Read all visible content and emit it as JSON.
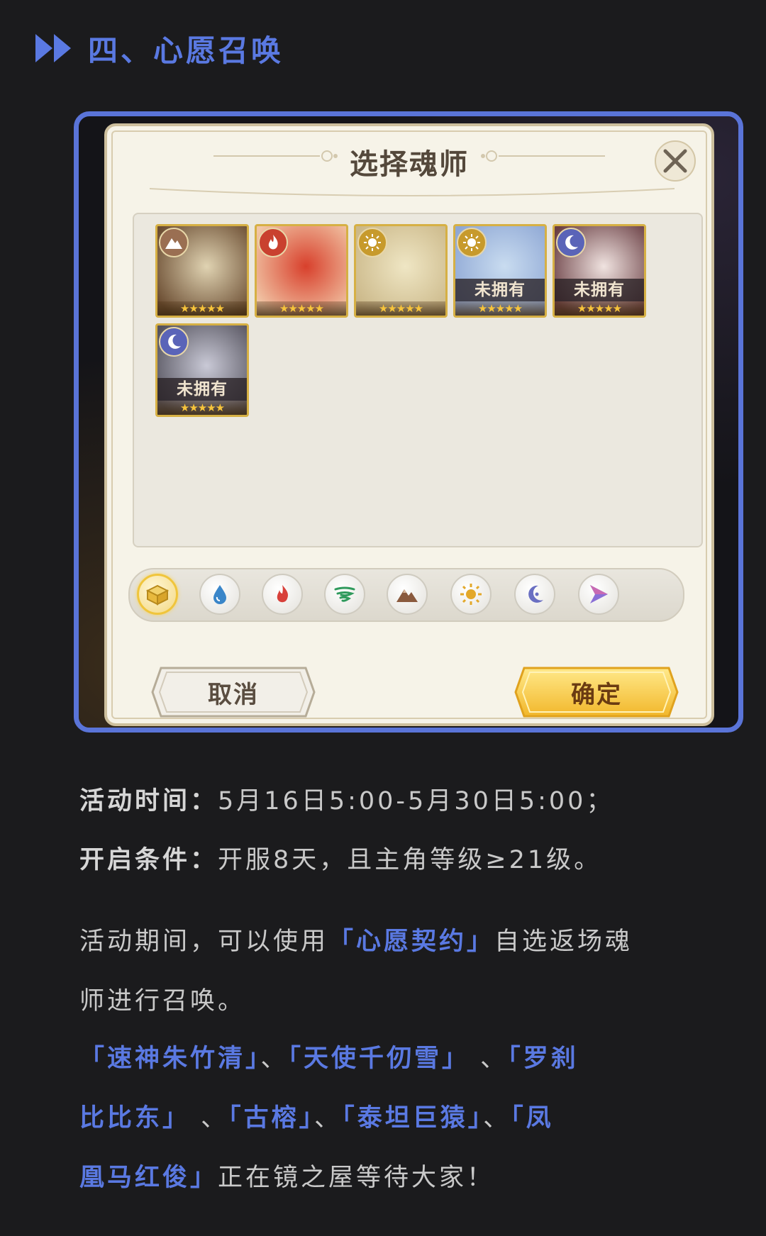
{
  "section": {
    "title": "四、心愿召唤"
  },
  "dialog": {
    "title": "选择魂师",
    "heroes": [
      {
        "element": "mountain",
        "owned": true,
        "badge": "",
        "stars": "★★★★★",
        "art_colors": [
          "#e0d3b2",
          "#6b4d32"
        ]
      },
      {
        "element": "fire",
        "owned": true,
        "badge": "",
        "stars": "★★★★★",
        "art_colors": [
          "#d8402c",
          "#f1c6a6"
        ]
      },
      {
        "element": "light",
        "owned": true,
        "badge": "",
        "stars": "★★★★★",
        "art_colors": [
          "#efe6c4",
          "#cbb889"
        ]
      },
      {
        "element": "light",
        "owned": false,
        "badge": "未拥有",
        "stars": "★★★★★",
        "art_colors": [
          "#c9dcf0",
          "#8ea7d4"
        ]
      },
      {
        "element": "dark",
        "owned": false,
        "badge": "未拥有",
        "stars": "★★★★★",
        "art_colors": [
          "#f0e3e0",
          "#6a3f44"
        ]
      },
      {
        "element": "dark",
        "owned": false,
        "badge": "未拥有",
        "stars": "★★★★★",
        "art_colors": [
          "#c9c9d6",
          "#55535e"
        ]
      }
    ],
    "filters": [
      "all-icon",
      "water-icon",
      "fire-icon",
      "wind-icon",
      "mountain-icon",
      "light-icon",
      "dark-icon",
      "special-icon"
    ],
    "active_filter": "all-icon",
    "cancel_label": "取消",
    "confirm_label": "确定"
  },
  "info": {
    "time_label": "活动时间：",
    "time_value": "5月16日5:00-5月30日5:00；",
    "cond_label": "开启条件：",
    "cond_value": "开服8天，且主角等级≥21级。",
    "desc_1": "活动期间，可以使用",
    "contract": "「心愿契约」",
    "desc_2": "自选返场魂",
    "desc_3": "师进行召唤。",
    "heroes_l1_a": "「速神朱竹清」",
    "heroes_l1_b": "、",
    "heroes_l1_c": "「天使千仞雪」",
    "heroes_l1_d": " 、",
    "heroes_l1_e": "「罗刹",
    "heroes_l2_a": "比比东」",
    "heroes_l2_b": " 、",
    "heroes_l2_c": "「古榕」",
    "heroes_l2_d": "、",
    "heroes_l2_e": "「泰坦巨猿」",
    "heroes_l2_f": "、",
    "heroes_l2_g": "「凤",
    "heroes_l3_a": "凰马红俊」",
    "heroes_l3_b": "正在镜之屋等待大家！"
  },
  "colors": {
    "accent": "#5a79e2",
    "frame": "#5a74d8",
    "background": "#1b1b1d"
  }
}
